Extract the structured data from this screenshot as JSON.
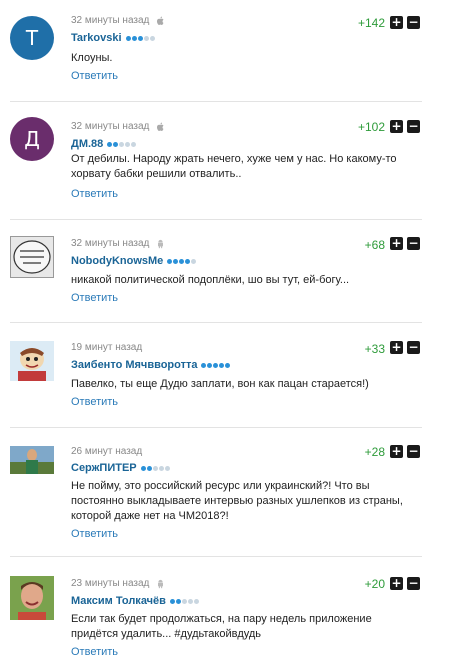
{
  "reply_label": "Ответить",
  "comments": [
    {
      "time": "32 минуты назад",
      "platform_icon": "apple-icon",
      "avatar_letter": "T",
      "avatar_color": "#1f6fa8",
      "author": "Tarkovski",
      "rank": 3,
      "text": "Клоуны.",
      "score": "+142"
    },
    {
      "time": "32 минуты назад",
      "platform_icon": "apple-icon",
      "avatar_letter": "Д",
      "avatar_color": "#6a2d6c",
      "author": "ДМ.88",
      "rank": 2,
      "text": "От дебилы. Народу жрать нечего, хуже чем у нас. Но какому-то хорвату бабки решили отвалить..",
      "score": "+102"
    },
    {
      "time": "32 минуты назад",
      "platform_icon": "android-icon",
      "avatar_letter": "",
      "author": "NobodyKnowsMe",
      "rank": 4,
      "text": "никакой политической подоплёки, шо вы тут, ей-богу...",
      "score": "+68"
    },
    {
      "time": "19 минут назад",
      "platform_icon": "",
      "avatar_letter": "",
      "author": "Заибенто Мячвворотта",
      "rank": 5,
      "text": "Павелко, ты еще Дудю заплати, вон как пацан старается!)",
      "score": "+33"
    },
    {
      "time": "26 минут назад",
      "platform_icon": "",
      "avatar_letter": "",
      "author": "СержПИТЕР",
      "rank": 2,
      "text": "Не пойму, это российский ресурс или украинский?! Что вы постоянно выкладываете интервью разных ушлепков из страны, которой даже нет на ЧМ2018?!",
      "score": "+28"
    },
    {
      "time": "23 минуты назад",
      "platform_icon": "android-icon",
      "avatar_letter": "",
      "author": "Максим Толкачёв",
      "rank": 2,
      "text": "Если так будет продолжаться, на пару недель приложение придётся удалить... #дудьтакойвдудь",
      "score": "+20"
    }
  ]
}
